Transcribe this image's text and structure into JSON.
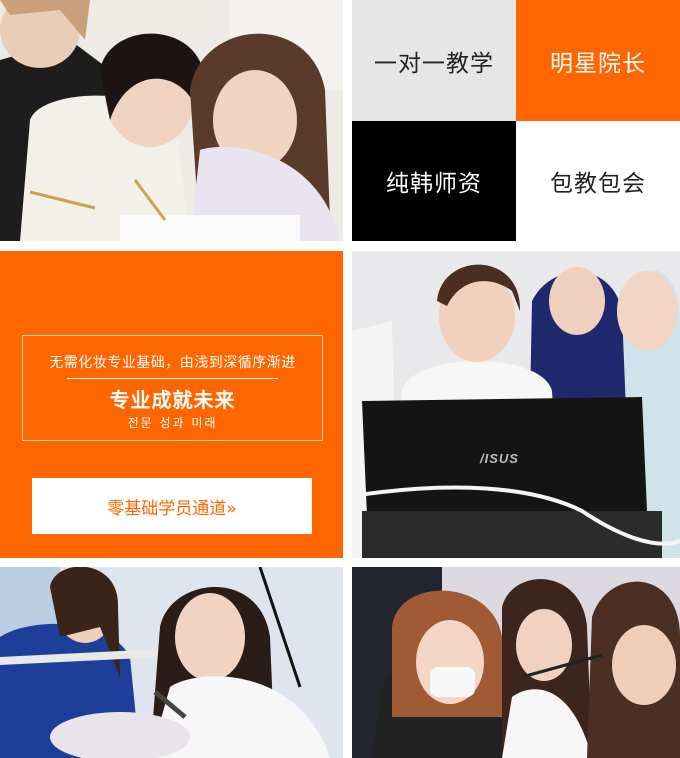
{
  "tiles": {
    "one_on_one": "一对一教学",
    "star_director": "明星院长",
    "korean_teachers": "纯韩师资",
    "guaranteed": "包教包会"
  },
  "banner": {
    "subtitle": "无需化妆专业基础，由浅到深循序渐进",
    "title": "专业成就未来",
    "korean_line": "전문 성과 미래",
    "cta_label": "零基础学员通道»"
  },
  "photos": {
    "laptop_brand": "/ISUS"
  },
  "colors": {
    "accent": "#ff6600",
    "tile_gray": "#e6e6e6",
    "tile_black": "#000000",
    "tile_white": "#ffffff"
  }
}
